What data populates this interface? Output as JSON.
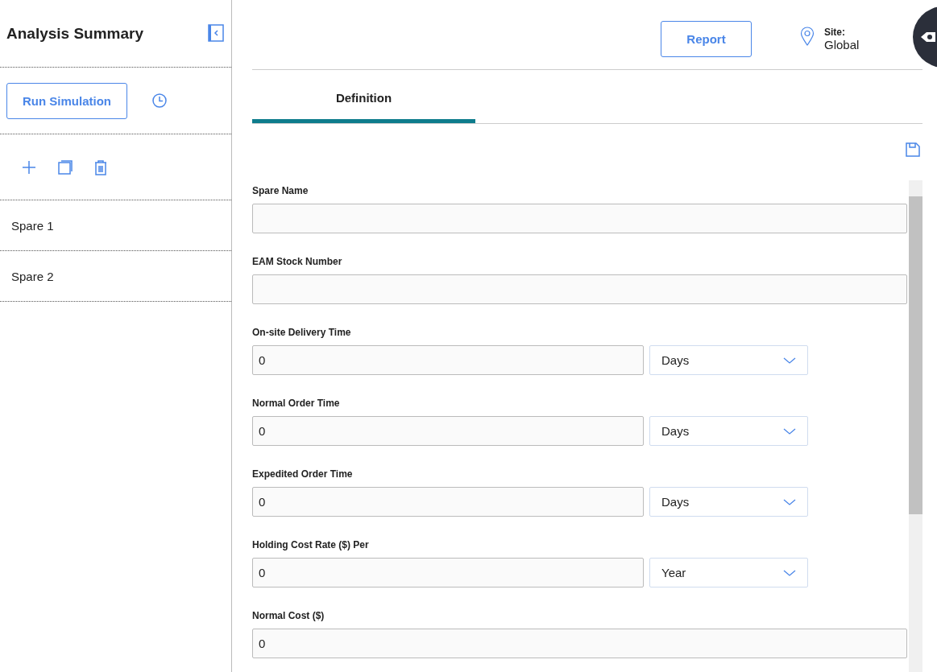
{
  "sidebar": {
    "title": "Analysis Summary",
    "run_button": "Run Simulation",
    "items": [
      {
        "label": "Spare 1",
        "selected": false
      },
      {
        "label": "Spare 2",
        "selected": false
      }
    ]
  },
  "header": {
    "report_button": "Report",
    "site_label": "Site:",
    "site_value": "Global"
  },
  "tabs": [
    {
      "label": "Definition",
      "selected": true
    }
  ],
  "fields": [
    {
      "kind": "text",
      "label": "Spare Name"
    },
    {
      "kind": "text",
      "label": "EAM Stock Number"
    },
    {
      "kind": "with_unit",
      "label": "On-site Delivery Time",
      "value": "0",
      "unit": "Days"
    },
    {
      "kind": "with_unit",
      "label": "Normal Order Time",
      "value": "0",
      "unit": "Days"
    },
    {
      "kind": "with_unit",
      "label": "Expedited Order Time",
      "value": "0",
      "unit": "Days"
    },
    {
      "kind": "with_unit",
      "label": "Holding Cost Rate ($) Per",
      "value": "0",
      "unit": "Year"
    },
    {
      "kind": "text",
      "label": "Normal Cost ($)",
      "value": "0"
    }
  ]
}
